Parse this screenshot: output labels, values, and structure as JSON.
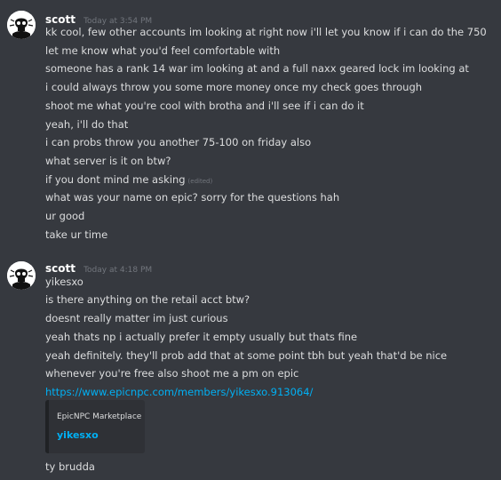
{
  "messages": [
    {
      "username": "scott",
      "timestamp": "Today at 3:54 PM",
      "lines": [
        "kk cool, few other accounts im looking at right now i'll let you know if i can do the 750",
        "let me know what you'd feel comfortable with",
        "someone has a rank 14 war im looking at and a full naxx geared lock im looking at",
        "i could always throw you some more money once my check goes through",
        "shoot me what you're cool with brotha and i'll see if i can do it",
        "yeah, i'll do that",
        "i can probs throw you another 75-100 on friday also",
        "what server is it on btw?",
        "if you dont mind me asking",
        "what was your name on epic? sorry for the questions hah",
        "ur good",
        "take ur time"
      ],
      "edited_label": "(edited)"
    },
    {
      "username": "scott",
      "timestamp": "Today at 4:18 PM",
      "lines": [
        "yikesxo",
        "is there anything on the retail acct btw?",
        "doesnt really matter im just curious",
        "yeah thats np i actually prefer it empty usually but thats fine",
        "yeah definitely. they'll prob add that at some point tbh but yeah that'd be nice",
        "whenever you're free also shoot me a pm on epic"
      ],
      "link": "https://www.epicnpc.com/members/yikesxo.913064/",
      "embed": {
        "provider": "EpicNPC Marketplace",
        "title": "yikesxo"
      },
      "after_embed": "ty brudda"
    }
  ]
}
